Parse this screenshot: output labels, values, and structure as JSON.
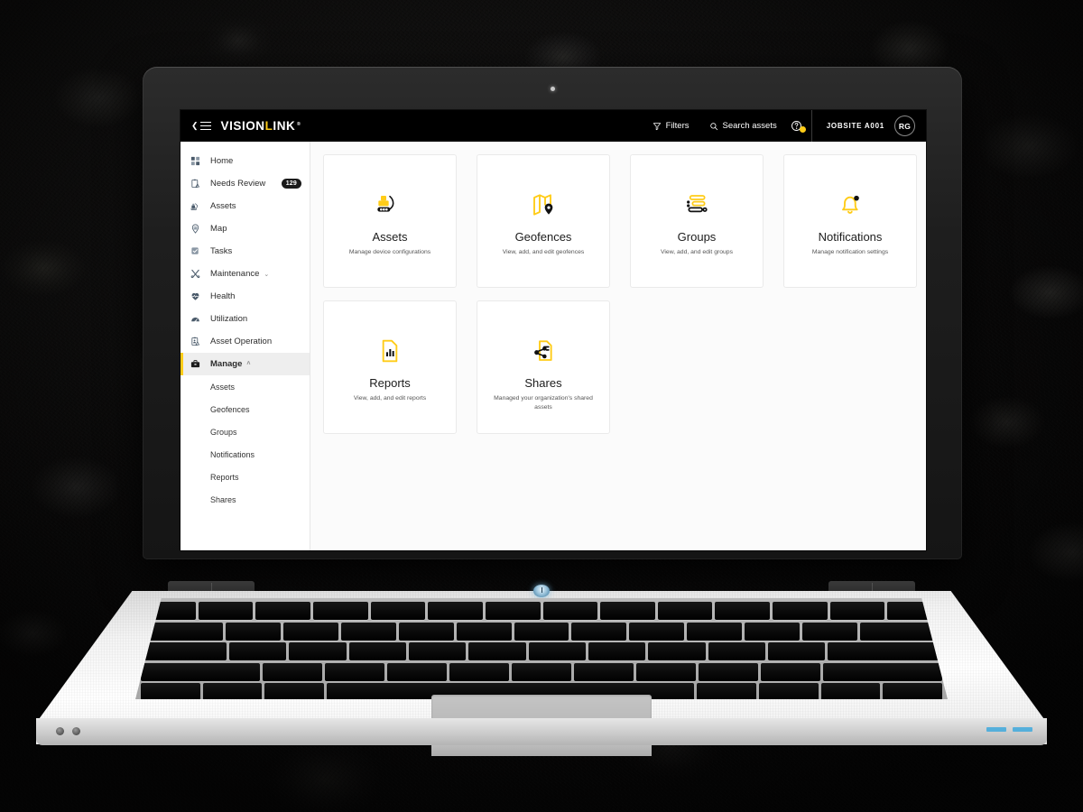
{
  "topbar": {
    "menu_icon": "collapse-menu-icon",
    "logo_prefix": "VISION",
    "logo_highlight": "L",
    "logo_suffix": "INK",
    "logo_registered": "®",
    "filters_label": "Filters",
    "filters_icon": "filter-funnel-icon",
    "search_label": "Search assets",
    "search_icon": "search-icon",
    "help_icon": "help-circle-icon",
    "jobsite_label": "JOBSITE A001",
    "avatar_initials": "RG"
  },
  "sidebar": {
    "items": [
      {
        "label": "Home",
        "icon": "grid-icon",
        "badge": null,
        "caret": null,
        "active": false
      },
      {
        "label": "Needs Review",
        "icon": "clipboard-alert-icon",
        "badge": "129",
        "caret": null,
        "active": false
      },
      {
        "label": "Assets",
        "icon": "excavator-icon",
        "badge": null,
        "caret": null,
        "active": false
      },
      {
        "label": "Map",
        "icon": "map-marker-icon",
        "badge": null,
        "caret": null,
        "active": false
      },
      {
        "label": "Tasks",
        "icon": "task-check-icon",
        "badge": null,
        "caret": null,
        "active": false
      },
      {
        "label": "Maintenance",
        "icon": "wrench-tools-icon",
        "badge": null,
        "caret": "⌄",
        "active": false
      },
      {
        "label": "Health",
        "icon": "heart-pulse-icon",
        "badge": null,
        "caret": null,
        "active": false
      },
      {
        "label": "Utilization",
        "icon": "gauge-icon",
        "badge": null,
        "caret": null,
        "active": false
      },
      {
        "label": "Asset Operation",
        "icon": "clipboard-person-icon",
        "badge": null,
        "caret": null,
        "active": false
      },
      {
        "label": "Manage",
        "icon": "briefcase-icon",
        "badge": null,
        "caret": "˄",
        "active": true
      }
    ],
    "sub_items": [
      {
        "label": "Assets"
      },
      {
        "label": "Geofences"
      },
      {
        "label": "Groups"
      },
      {
        "label": "Notifications"
      },
      {
        "label": "Reports"
      },
      {
        "label": "Shares"
      }
    ]
  },
  "main": {
    "cards": [
      {
        "title": "Assets",
        "desc": "Manage device configurations",
        "icon": "excavator-icon"
      },
      {
        "title": "Geofences",
        "desc": "View, add, and edit geofences",
        "icon": "geofence-map-pin-icon"
      },
      {
        "title": "Groups",
        "desc": "View, add, and edit groups",
        "icon": "groups-bars-icon"
      },
      {
        "title": "Notifications",
        "desc": "Manage notification settings",
        "icon": "bell-alert-icon"
      },
      {
        "title": "Reports",
        "desc": "View, add, and edit reports",
        "icon": "report-chart-doc-icon"
      },
      {
        "title": "Shares",
        "desc": "Managed your organization's shared assets",
        "icon": "share-doc-icon"
      }
    ]
  },
  "colors": {
    "brand_yellow": "#FFCC18",
    "topbar_black": "#000000",
    "active_nav_bg": "#EEEEEE",
    "content_bg": "#FBFBFB"
  }
}
